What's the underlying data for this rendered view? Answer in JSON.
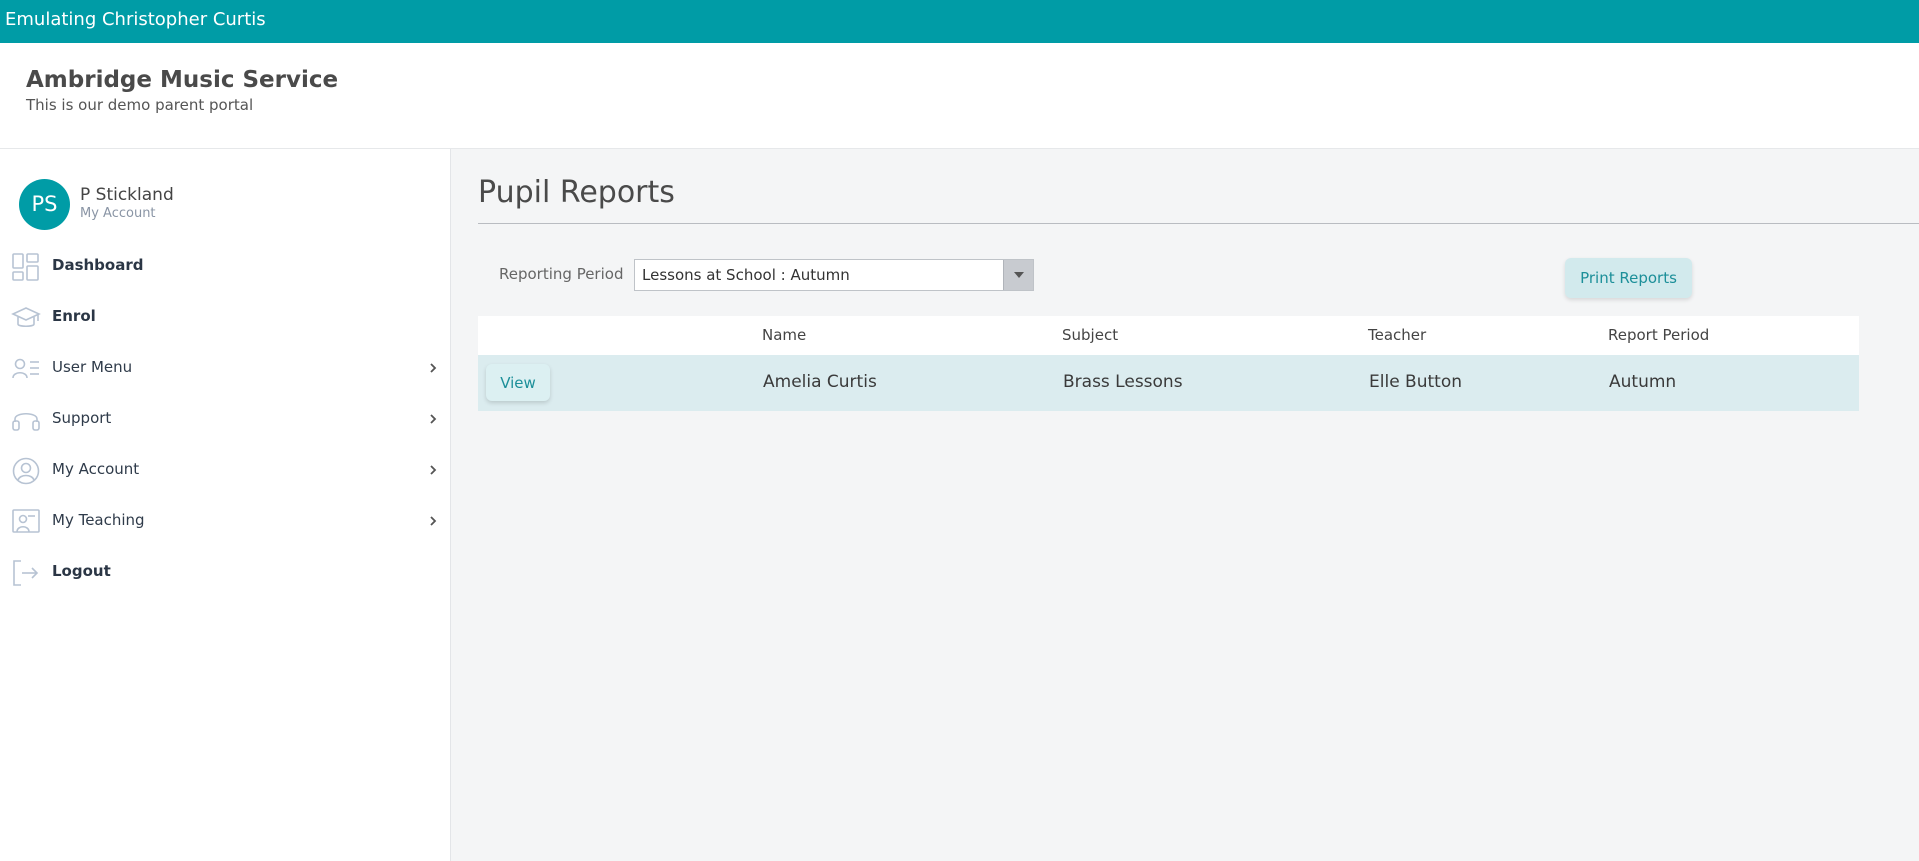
{
  "topbar": {
    "emulating": "Emulating Christopher Curtis",
    "color": "#009ca6"
  },
  "header": {
    "org_name": "Ambridge Music Service",
    "subtitle": "This is our demo parent portal"
  },
  "user": {
    "initials": "PS",
    "name": "P Stickland",
    "account_link": "My Account"
  },
  "nav": {
    "items": [
      {
        "label": "Dashboard",
        "icon": "dashboard-icon",
        "has_submenu": false
      },
      {
        "label": "Enrol",
        "icon": "graduation-cap-icon",
        "has_submenu": false
      },
      {
        "label": "User Menu",
        "icon": "user-list-icon",
        "has_submenu": true
      },
      {
        "label": "Support",
        "icon": "headset-icon",
        "has_submenu": true
      },
      {
        "label": "My Account",
        "icon": "user-circle-icon",
        "has_submenu": true
      },
      {
        "label": "My Teaching",
        "icon": "teacher-board-icon",
        "has_submenu": true
      },
      {
        "label": "Logout",
        "icon": "logout-icon",
        "has_submenu": false
      }
    ]
  },
  "main": {
    "title": "Pupil Reports",
    "filter": {
      "label": "Reporting Period",
      "selected": "Lessons at School : Autumn"
    },
    "print_button": "Print Reports",
    "table": {
      "columns": [
        "Name",
        "Subject",
        "Teacher",
        "Report Period"
      ],
      "rows": [
        {
          "action": "View",
          "name": "Amelia Curtis",
          "subject": "Brass Lessons",
          "teacher": "Elle Button",
          "period": "Autumn"
        }
      ]
    }
  }
}
